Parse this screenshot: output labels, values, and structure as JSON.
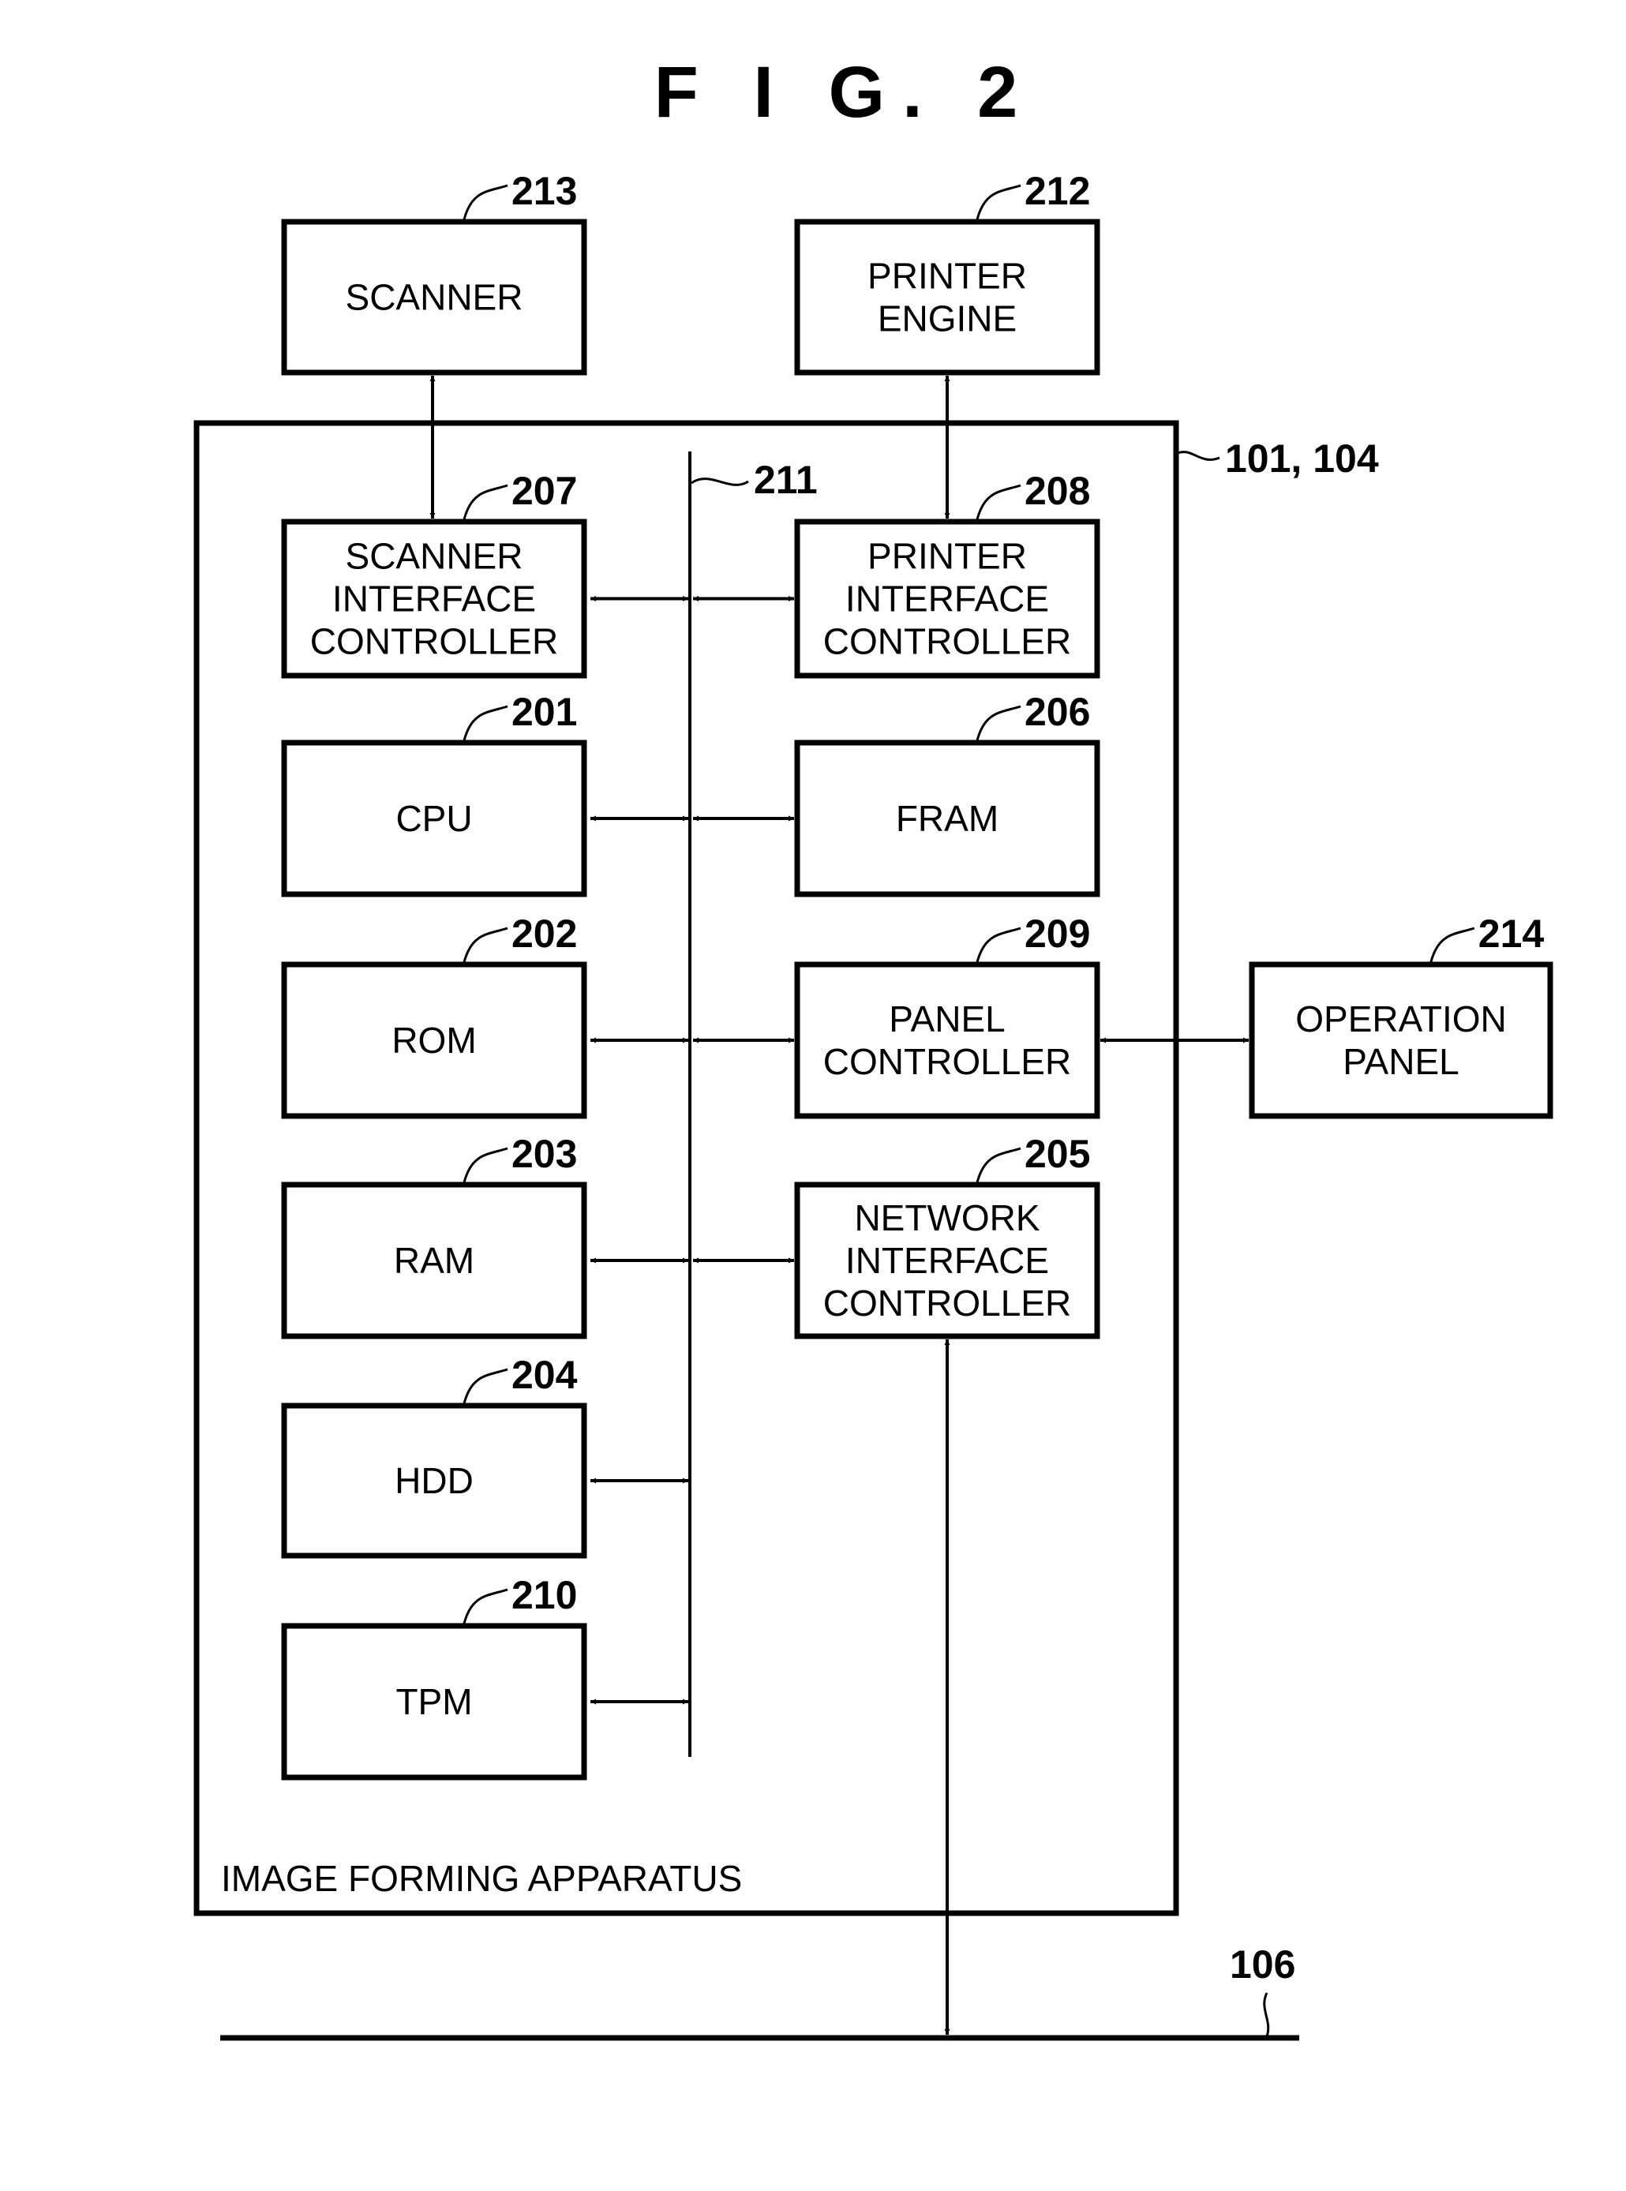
{
  "figure": {
    "title": "F I G. 2",
    "apparatus_label": "IMAGE FORMING APPARATUS",
    "apparatus_ref": "101, 104",
    "bus_ref": "211",
    "network_ref": "106"
  },
  "blocks": {
    "scanner": {
      "ref": "213",
      "lines": [
        "SCANNER"
      ]
    },
    "printer_engine": {
      "ref": "212",
      "lines": [
        "PRINTER",
        "ENGINE"
      ]
    },
    "scanner_if": {
      "ref": "207",
      "lines": [
        "SCANNER",
        "INTERFACE",
        "CONTROLLER"
      ]
    },
    "printer_if": {
      "ref": "208",
      "lines": [
        "PRINTER",
        "INTERFACE",
        "CONTROLLER"
      ]
    },
    "cpu": {
      "ref": "201",
      "lines": [
        "CPU"
      ]
    },
    "fram": {
      "ref": "206",
      "lines": [
        "FRAM"
      ]
    },
    "rom": {
      "ref": "202",
      "lines": [
        "ROM"
      ]
    },
    "panel_ctrl": {
      "ref": "209",
      "lines": [
        "PANEL",
        "CONTROLLER"
      ]
    },
    "ram": {
      "ref": "203",
      "lines": [
        "RAM"
      ]
    },
    "network_if": {
      "ref": "205",
      "lines": [
        "NETWORK",
        "INTERFACE",
        "CONTROLLER"
      ]
    },
    "hdd": {
      "ref": "204",
      "lines": [
        "HDD"
      ]
    },
    "tpm": {
      "ref": "210",
      "lines": [
        "TPM"
      ]
    },
    "operation_panel": {
      "ref": "214",
      "lines": [
        "OPERATION",
        "PANEL"
      ]
    }
  }
}
